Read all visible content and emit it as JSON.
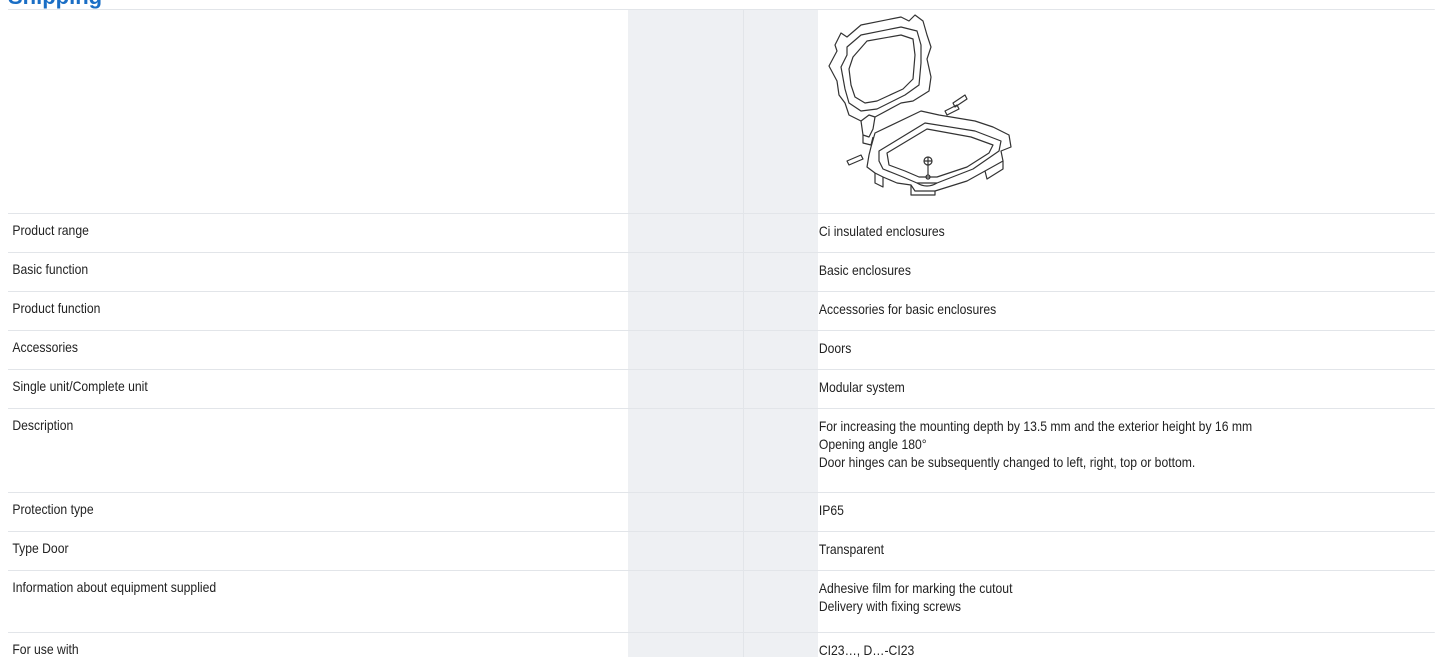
{
  "heading": "Shipping",
  "rows": [
    {
      "label": "Product range",
      "lines": [
        "Ci insulated enclosures"
      ]
    },
    {
      "label": "Basic function",
      "lines": [
        "Basic enclosures"
      ]
    },
    {
      "label": "Product function",
      "lines": [
        "Accessories for basic enclosures"
      ]
    },
    {
      "label": "Accessories",
      "lines": [
        "Doors"
      ]
    },
    {
      "label": "Single unit/Complete unit",
      "lines": [
        "Modular system"
      ]
    },
    {
      "label": "Description",
      "lines": [
        "For increasing the mounting depth by 13.5 mm and the exterior height by 16 mm",
        "Opening angle 180°",
        "Door hinges can be subsequently changed to left, right, top or bottom."
      ]
    },
    {
      "label": "Protection type",
      "lines": [
        "IP65"
      ]
    },
    {
      "label": "Type Door",
      "lines": [
        "Transparent"
      ]
    },
    {
      "label": "Information about equipment supplied",
      "lines": [
        "Adhesive film for marking the cutout",
        "Delivery with fixing screws"
      ]
    },
    {
      "label": "For use with",
      "lines": [
        "CI23…, D…-CI23"
      ]
    }
  ],
  "colors": {
    "heading": "#1a6ec5",
    "grey_column": "#eef0f3",
    "divider": "#e2e5e9",
    "text": "#222222"
  }
}
